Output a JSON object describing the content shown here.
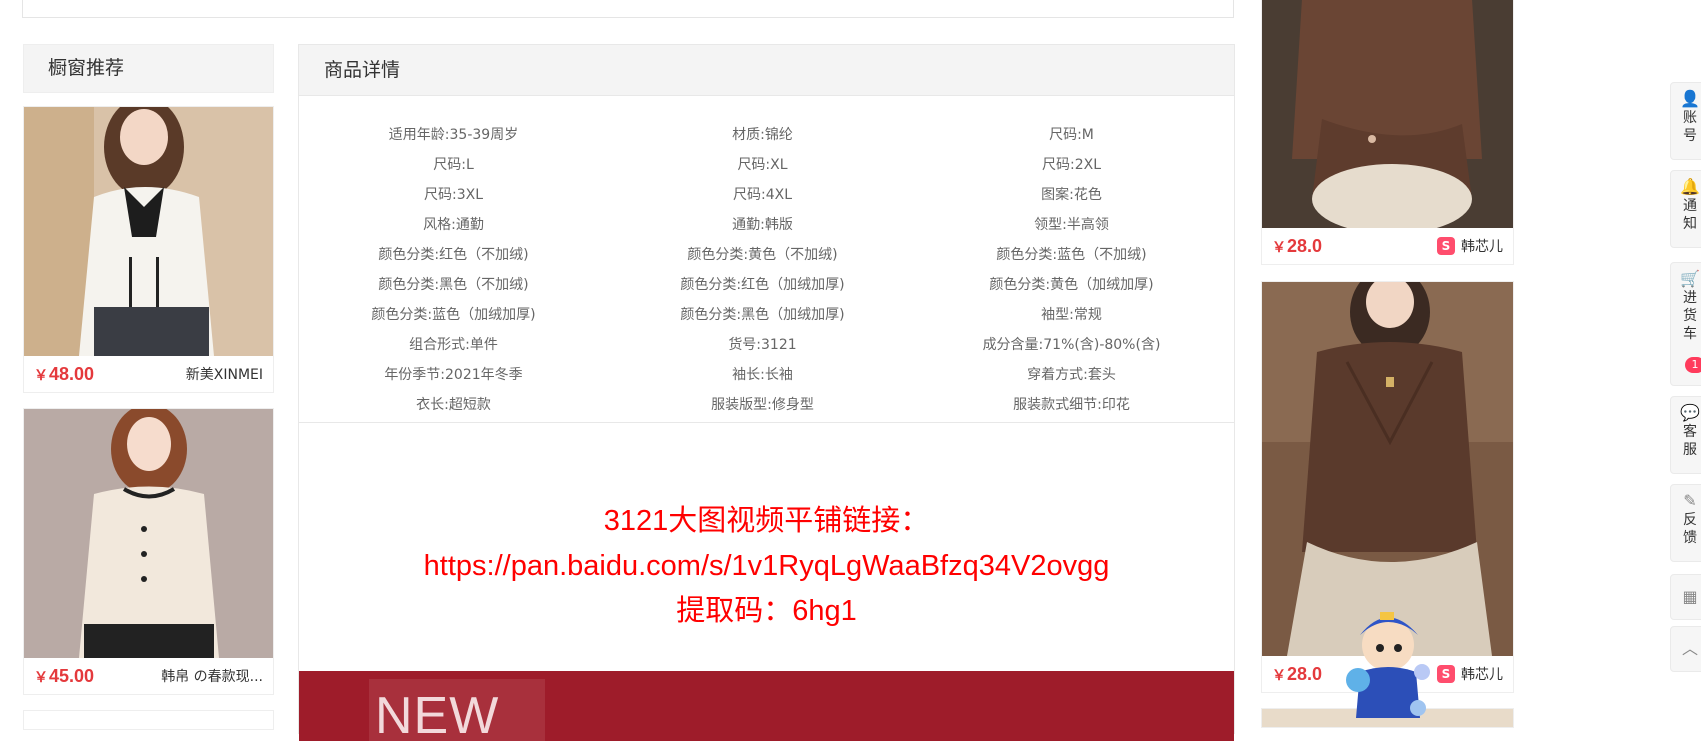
{
  "sidebar_left": {
    "title": "橱窗推荐",
    "items": [
      {
        "price_symbol": "￥",
        "price": "48.00",
        "shop": "新美XINMEI"
      },
      {
        "price_symbol": "￥",
        "price": "45.00",
        "shop": "韩帛 の春款现..."
      }
    ]
  },
  "main": {
    "title": "商品详情",
    "attributes": [
      "适用年龄:35-39周岁",
      "材质:锦纶",
      "尺码:M",
      "尺码:L",
      "尺码:XL",
      "尺码:2XL",
      "尺码:3XL",
      "尺码:4XL",
      "图案:花色",
      "风格:通勤",
      "通勤:韩版",
      "领型:半高领",
      "颜色分类:红色（不加绒)",
      "颜色分类:黄色（不加绒)",
      "颜色分类:蓝色（不加绒)",
      "颜色分类:黑色（不加绒)",
      "颜色分类:红色（加绒加厚)",
      "颜色分类:黄色（加绒加厚)",
      "颜色分类:蓝色（加绒加厚)",
      "颜色分类:黑色（加绒加厚)",
      "袖型:常规",
      "组合形式:单件",
      "货号:3121",
      "成分含量:71%(含)-80%(含)",
      "年份季节:2021年冬季",
      "袖长:长袖",
      "穿着方式:套头",
      "衣长:超短款",
      "服装版型:修身型",
      "服装款式细节:印花"
    ],
    "link_lines": [
      "3121大图视频平铺链接：",
      "https://pan.baidu.com/s/1v1RyqLgWaaBfzq34V2ovgg",
      "提取码：6hg1"
    ],
    "banner_text": "NEW"
  },
  "right_column": {
    "items": [
      {
        "price_symbol": "￥",
        "price": "28.0",
        "shop_badge": "S",
        "shop": "韩芯儿"
      },
      {
        "price_symbol": "￥",
        "price": "28.0",
        "shop_badge": "S",
        "shop": "韩芯儿"
      }
    ]
  },
  "toolbar": {
    "account": "账号",
    "notify": "通知",
    "cart": "进货车",
    "cart_count": "1",
    "service": "客服",
    "feedback": "反馈"
  },
  "icons": {
    "account": "user-icon",
    "notify": "bell-icon",
    "cart": "cart-icon",
    "service": "chat-icon",
    "feedback": "pen-icon",
    "qrcode": "qrcode-icon",
    "top": "chevron-up-icon"
  },
  "colors": {
    "price": "#e4393c",
    "link_text": "#ff0000",
    "banner": "#9e1c2a",
    "badge": "#ff3b5c"
  }
}
